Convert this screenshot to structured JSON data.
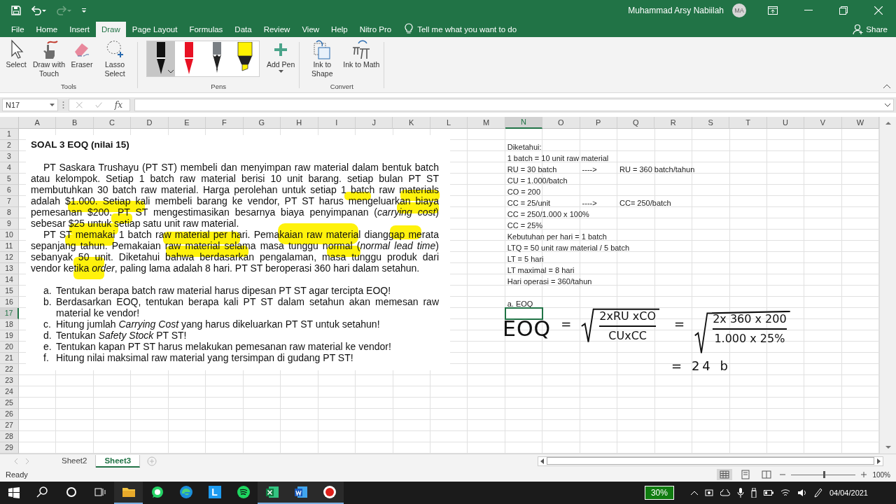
{
  "title_bar": {
    "user": "Muhammad Arsy Nabiilah",
    "initials": "MA"
  },
  "tabs": [
    {
      "label": "File",
      "selected": false
    },
    {
      "label": "Home",
      "selected": false
    },
    {
      "label": "Insert",
      "selected": false
    },
    {
      "label": "Draw",
      "selected": true
    },
    {
      "label": "Page Layout",
      "selected": false
    },
    {
      "label": "Formulas",
      "selected": false
    },
    {
      "label": "Data",
      "selected": false
    },
    {
      "label": "Review",
      "selected": false
    },
    {
      "label": "View",
      "selected": false
    },
    {
      "label": "Help",
      "selected": false
    },
    {
      "label": "Nitro Pro",
      "selected": false
    }
  ],
  "tell_me": "Tell me what you want to do",
  "share": "Share",
  "tools_group": {
    "label": "Tools",
    "buttons": [
      {
        "kind": "select",
        "label": "Select"
      },
      {
        "kind": "touch",
        "label": "Draw with Touch"
      },
      {
        "kind": "eraser",
        "label": "Eraser"
      },
      {
        "kind": "lasso",
        "label": "Lasso Select"
      }
    ]
  },
  "pens_group": {
    "label": "Pens",
    "pens": [
      {
        "kind": "pen",
        "color": "#111111",
        "selected": true
      },
      {
        "kind": "pen",
        "color": "#e81123",
        "selected": false
      },
      {
        "kind": "pencil",
        "color": "#7a7f84",
        "selected": false
      },
      {
        "kind": "highlighter",
        "color": "#fff200",
        "selected": false
      }
    ],
    "add_pen": "Add Pen"
  },
  "convert_group": {
    "label": "Convert",
    "buttons": [
      {
        "kind": "shape",
        "label": "Ink to Shape"
      },
      {
        "kind": "math",
        "label": "Ink to Math"
      }
    ]
  },
  "name_box": "N17",
  "function_label": "fx",
  "columns": [
    {
      "label": "A",
      "selected": false
    },
    {
      "label": "B",
      "selected": false
    },
    {
      "label": "C",
      "selected": false
    },
    {
      "label": "D",
      "selected": false
    },
    {
      "label": "E",
      "selected": false
    },
    {
      "label": "F",
      "selected": false
    },
    {
      "label": "G",
      "selected": false
    },
    {
      "label": "H",
      "selected": false
    },
    {
      "label": "I",
      "selected": false
    },
    {
      "label": "J",
      "selected": false
    },
    {
      "label": "K",
      "selected": false
    },
    {
      "label": "L",
      "selected": false
    },
    {
      "label": "M",
      "selected": false
    },
    {
      "label": "N",
      "selected": true
    },
    {
      "label": "O",
      "selected": false
    },
    {
      "label": "P",
      "selected": false
    },
    {
      "label": "Q",
      "selected": false
    },
    {
      "label": "R",
      "selected": false
    },
    {
      "label": "S",
      "selected": false
    },
    {
      "label": "T",
      "selected": false
    },
    {
      "label": "U",
      "selected": false
    },
    {
      "label": "V",
      "selected": false
    },
    {
      "label": "W",
      "selected": false
    }
  ],
  "rows": [
    {
      "label": "1",
      "selected": false
    },
    {
      "label": "2",
      "selected": false
    },
    {
      "label": "3",
      "selected": false
    },
    {
      "label": "4",
      "selected": false
    },
    {
      "label": "5",
      "selected": false
    },
    {
      "label": "6",
      "selected": false
    },
    {
      "label": "7",
      "selected": false
    },
    {
      "label": "8",
      "selected": false
    },
    {
      "label": "9",
      "selected": false
    },
    {
      "label": "10",
      "selected": false
    },
    {
      "label": "11",
      "selected": false
    },
    {
      "label": "12",
      "selected": false
    },
    {
      "label": "13",
      "selected": false
    },
    {
      "label": "14",
      "selected": false
    },
    {
      "label": "15",
      "selected": false
    },
    {
      "label": "16",
      "selected": false
    },
    {
      "label": "17",
      "selected": true
    },
    {
      "label": "18",
      "selected": false
    },
    {
      "label": "19",
      "selected": false
    },
    {
      "label": "20",
      "selected": false
    },
    {
      "label": "21",
      "selected": false
    },
    {
      "label": "22",
      "selected": false
    },
    {
      "label": "23",
      "selected": false
    },
    {
      "label": "24",
      "selected": false
    },
    {
      "label": "25",
      "selected": false
    },
    {
      "label": "26",
      "selected": false
    },
    {
      "label": "27",
      "selected": false
    },
    {
      "label": "28",
      "selected": false
    },
    {
      "label": "29",
      "selected": false
    }
  ],
  "notes": [
    {
      "text": "Diketahui:"
    },
    {
      "text": "1 batch = 10 unit raw material"
    },
    {
      "text": "RU = 30 batch",
      "arrow": "---->",
      "converted": "RU = 360 batch/tahun"
    },
    {
      "text": "CU = 1.000/batch"
    },
    {
      "text": "CO = 200"
    },
    {
      "text": "CC = 25/unit",
      "arrow": "---->",
      "converted": "CC= 250/batch"
    },
    {
      "text": "CC = 250/1.000 x 100%"
    },
    {
      "text": "CC = 25%"
    },
    {
      "text": "Kebutuhan per hari = 1 batch"
    },
    {
      "text": "LTQ = 50 unit raw material / 5 batch"
    },
    {
      "text": "LT = 5 hari"
    },
    {
      "text": "LT maximal = 8 hari"
    },
    {
      "text": "Hari operasi = 360/tahun"
    }
  ],
  "answer_label": "a. EOQ",
  "document": {
    "title": "SOAL 3 EOQ (nilai 15)",
    "paragraphs": [
      "PT Saskara Trushayu (PT ST) membeli dan menyimpan raw material dalam bentuk batch atau kelompok. Setiap 1 batch raw material berisi 10 unit barang. setiap bulan PT ST membutuhkan 30 batch raw material. Harga perolehan untuk setiap 1 batch raw materials adalah $1.000. Setiap kali membeli barang ke vendor, PT ST harus mengeluarkan biaya pemesanan $200. PT ST mengestimasikan besarnya biaya penyimpanan (*carrying cost*) sebesar $25 untuk setiap satu unit raw material.",
      "PT ST memakai 1 batch raw material per hari. Pemakaian raw material dianggap merata sepanjang tahun. Pemakaian raw material selama masa tunggu normal (*normal lead time*) sebanyak 50 unit. Diketahui bahwa berdasarkan pengalaman, masa tunggu produk dari vendor ketika *order*, paling lama adalah 8 hari.  PT ST beroperasi 360 hari dalam setahun."
    ],
    "questions": [
      {
        "letter": "a.",
        "text": "Tentukan berapa batch raw material harus dipesan PT ST agar tercipta EOQ!"
      },
      {
        "letter": "b.",
        "text": "Berdasarkan EOQ, tentukan berapa kali PT ST dalam setahun akan memesan raw material ke vendor!"
      },
      {
        "letter": "c.",
        "text": "Hitung jumlah *Carrying Cost* yang harus dikeluarkan PT ST untuk setahun!"
      },
      {
        "letter": "d.",
        "text": "Tentukan *Safety Stock* PT ST!"
      },
      {
        "letter": "e.",
        "text": "Tentukan kapan PT ST harus melakukan pemesanan raw material ke vendor!"
      },
      {
        "letter": "f.",
        "text": "Hitung nilai maksimal raw material yang tersimpan di gudang PT ST!"
      }
    ]
  },
  "ink": {
    "lhs": "EOQ",
    "eq1": "=",
    "formula_num": "2xRU xCO",
    "formula_den": "CUxCC",
    "eq2": "=",
    "value_num": "2x 360 x 200",
    "value_den": "1.000 x 25%",
    "result": "= 24 b"
  },
  "sheet_tabs": [
    {
      "label": "Sheet2",
      "selected": false
    },
    {
      "label": "Sheet3",
      "selected": true
    }
  ],
  "status": "Ready",
  "zoom": {
    "level": 0.5,
    "reading": "100%"
  },
  "taskbar": {
    "apps": [
      {
        "kind": "search",
        "running": false
      },
      {
        "kind": "cortana",
        "running": false
      },
      {
        "kind": "taskview",
        "running": false
      },
      {
        "kind": "folder",
        "running": true
      },
      {
        "kind": "whatsapp",
        "running": false
      },
      {
        "kind": "edge",
        "running": false
      },
      {
        "kind": "letter",
        "label": "L",
        "running": false
      },
      {
        "kind": "spotify",
        "running": false
      },
      {
        "kind": "excel",
        "running": true
      },
      {
        "kind": "word",
        "running": true
      },
      {
        "kind": "record",
        "running": true
      }
    ],
    "battery": "30%",
    "date": "04/04/2021"
  }
}
